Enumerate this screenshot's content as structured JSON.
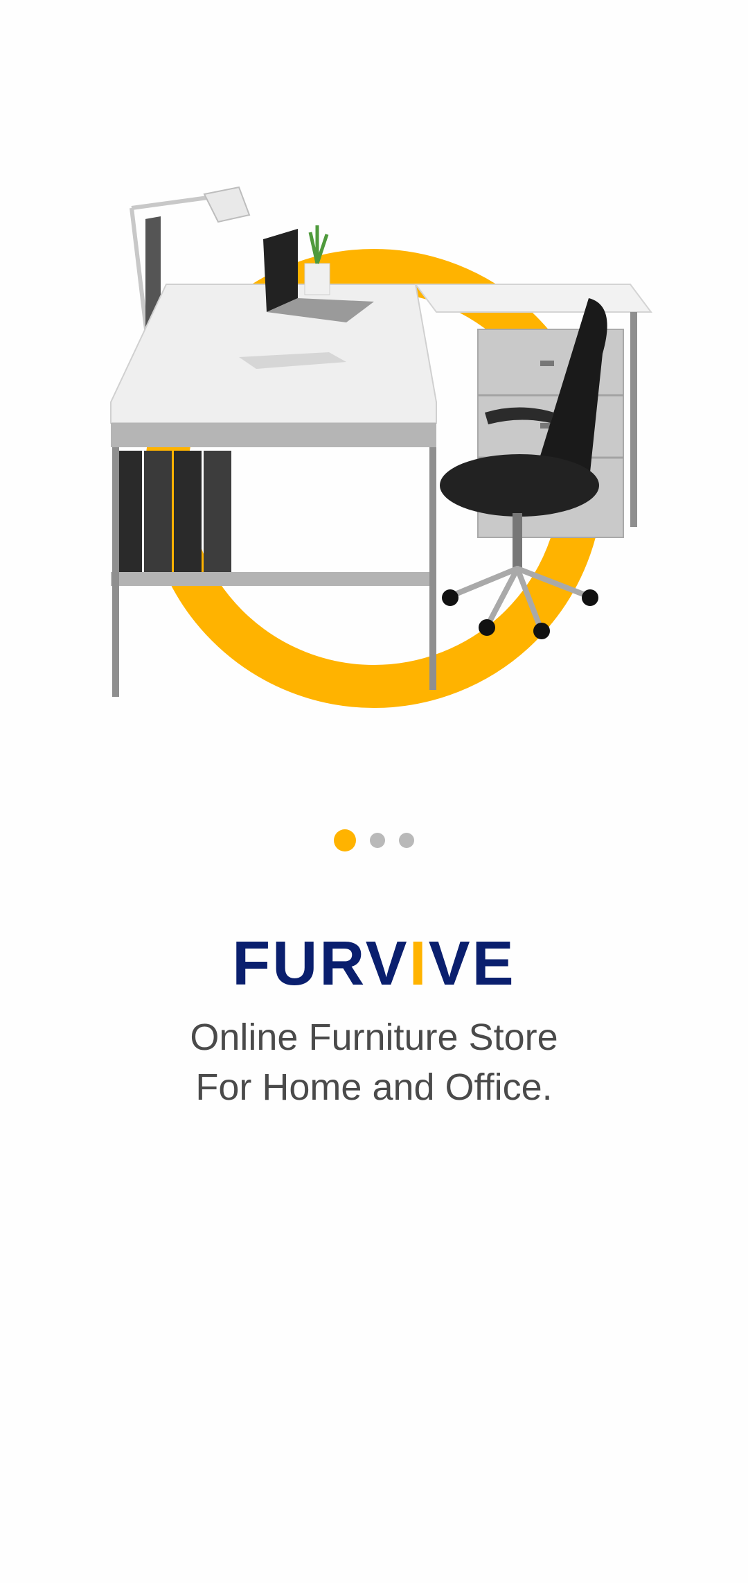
{
  "onboarding": {
    "brand": {
      "part1": "FURV",
      "accent": "I",
      "part2": "VE"
    },
    "tagline": {
      "line1": "Online Furniture Store",
      "line2": "For Home and Office."
    },
    "pager": {
      "total": 3,
      "active_index": 0
    }
  },
  "colors": {
    "accent": "#ffb300",
    "brand": "#0a1f6e",
    "text": "#4a4a4a",
    "dot_inactive": "#b9b9b9"
  },
  "icons": {
    "hero": "office-desk-illustration"
  }
}
